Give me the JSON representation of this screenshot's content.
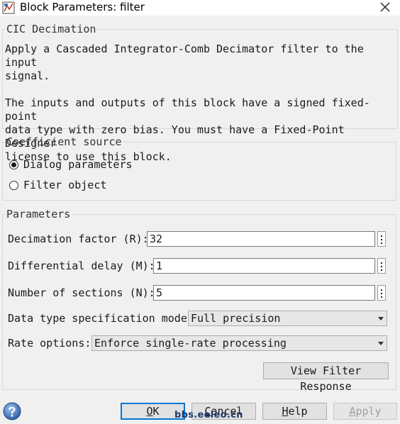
{
  "window": {
    "title": "Block Parameters: filter",
    "app_icon": "simulink-block-icon",
    "close_icon": "close-icon"
  },
  "description": {
    "legend": "CIC Decimation",
    "text": "Apply a Cascaded Integrator-Comb Decimator filter to the input\nsignal.\n\nThe inputs and outputs of this block have a signed fixed-point\ndata type with zero bias. You must have a Fixed-Point Designer\nlicense to use this block."
  },
  "coefficient_source": {
    "legend": "Coefficient source",
    "options": [
      {
        "label": "Dialog parameters",
        "selected": true
      },
      {
        "label": "Filter object",
        "selected": false
      }
    ]
  },
  "parameters": {
    "legend": "Parameters",
    "decimation_factor": {
      "label": "Decimation factor (R):",
      "value": "32"
    },
    "differential_delay": {
      "label": "Differential delay (M):",
      "value": "1"
    },
    "number_of_sections": {
      "label": "Number of sections (N):",
      "value": "5"
    },
    "data_type_mode": {
      "label": "Data type specification mode:",
      "value": "Full precision"
    },
    "rate_options": {
      "label": "Rate options:",
      "value": "Enforce single-rate processing"
    },
    "view_filter_response_label": "View Filter Response"
  },
  "footer": {
    "ok_mnemonic": "O",
    "ok_rest": "K",
    "cancel_mnemonic": "C",
    "cancel_rest": "ancel",
    "help_mnemonic": "H",
    "help_rest": "elp",
    "apply_mnemonic": "A",
    "apply_rest": "pply",
    "help_icon": "question-mark-icon",
    "watermark": "bbs.eeleo.cn"
  },
  "colors": {
    "background": "#f0f0f0",
    "focus_accent": "#0078d7",
    "help_icon_blue": "#3b6fb6"
  }
}
